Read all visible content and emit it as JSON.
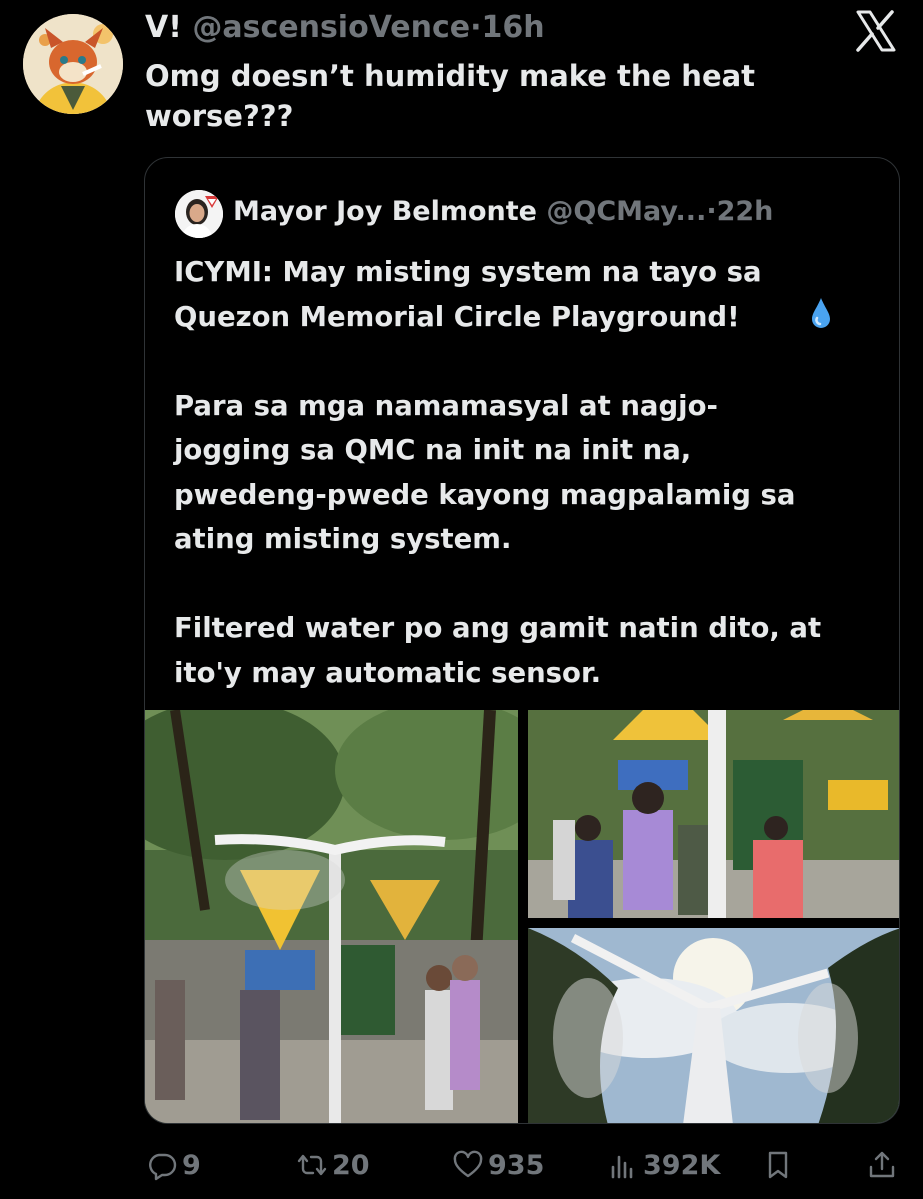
{
  "tweet": {
    "author_name": "V!",
    "author_handle": "@ascensioVence",
    "separator": "·",
    "time": "16h",
    "text": "Omg doesn’t humidity make the heat\nworse???"
  },
  "quoted_tweet": {
    "author_name": "Mayor Joy Belmonte",
    "author_handle": "@QCMay...",
    "separator": "·",
    "time": "22h",
    "text": "ICYMI: May misting system na tayo sa\nQuezon Memorial Circle Playground!\n\nPara sa mga namamasyal at nagjo-\njogging sa QMC na init na init na,\npwedeng-pwede kayong magpalamig sa\nating misting system.\n\nFiltered water po ang gamit natin dito, at\nito'y may automatic sensor.",
    "inline_emoji": "droplet-icon",
    "media": [
      {
        "description": "playground-misting-pole-photo"
      },
      {
        "description": "children-under-mist-photo"
      },
      {
        "description": "mist-pole-sky-photo"
      }
    ]
  },
  "actions": {
    "replies": "9",
    "reposts": "20",
    "likes": "935",
    "views": "392K"
  },
  "colors": {
    "background": "#000000",
    "text_primary": "#e7e9ea",
    "text_secondary": "#71767b",
    "border": "#2f3336"
  }
}
